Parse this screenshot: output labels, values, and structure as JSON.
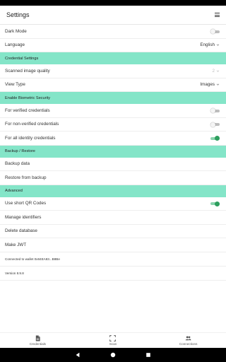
{
  "app_title": "Settings",
  "settings": {
    "dark_mode": {
      "label": "Dark Mode",
      "enabled": false
    },
    "language": {
      "label": "Language",
      "value": "English"
    },
    "credential_settings_header": "Credential Settings",
    "scanned_image_quality": {
      "label": "Scanned image quality",
      "value": "2"
    },
    "view_type": {
      "label": "View Type",
      "value": "Images"
    },
    "biometric_header": "Enable Biometric Security",
    "verified_credentials": {
      "label": "For verified credentials",
      "enabled": false
    },
    "non_verified_credentials": {
      "label": "For non-verified credentials",
      "enabled": false
    },
    "all_identity_credentials": {
      "label": "For all identity credentials",
      "enabled": true
    },
    "backup_restore_header": "Backup / Restore",
    "backup_data": "Backup data",
    "restore_from_backup": "Restore from backup",
    "advanced_header": "Advanced",
    "short_qr_codes": {
      "label": "Use short QR Codes",
      "enabled": true
    },
    "manage_identifiers": "Manage identifiers",
    "delete_database": "Delete database",
    "make_jwt": "Make JWT",
    "connected_wallet": "Connected to wallet 0x84EA83...B8Be",
    "version": "Version 8.9.8"
  },
  "bottom_nav": {
    "credentials": {
      "label": "Credentials",
      "icon": "document-icon"
    },
    "scan": {
      "label": "Scan",
      "icon": "scan-frame-icon"
    },
    "connections": {
      "label": "Connections",
      "icon": "people-icon"
    }
  },
  "colors": {
    "section_header_bg": "#84e5c8",
    "toggle_on": "#2e9e5e",
    "toggle_off_track": "#bdbdbd"
  }
}
